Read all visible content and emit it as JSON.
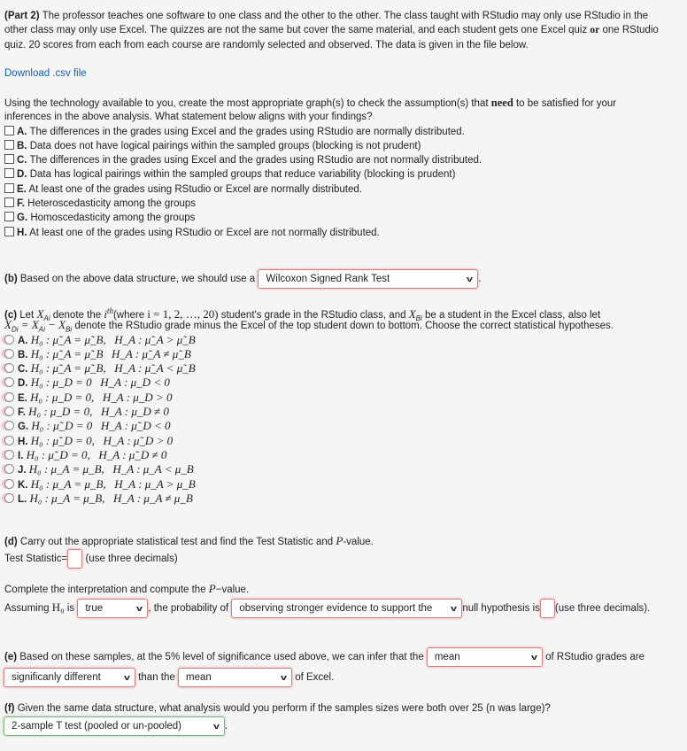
{
  "intro": {
    "part_label": "(Part 2)",
    "lines": [
      "The professor teaches one software to one class and the other to the other. The class taught with RStudio may only use RStudio in the",
      "other class may only use Excel. The quizzes are not the same but cover the same material, and each student gets one Excel quiz",
      "quiz. 20 scores from each from each course are randomly selected and observed. The data is given in the file below."
    ],
    "or_word": "or",
    "line2_end": "one RStudio",
    "download_link": "Download .csv file"
  },
  "part_a": {
    "prompt_1a": "Using the technology available to you, create the most appropriate graph(s) to check the assumption(s) that",
    "need_word": "need",
    "prompt_1b": "to be satisfied for your",
    "prompt_2": "inferences in the above analysis. What statement below aligns with your findings?",
    "options": [
      {
        "letter": "A.",
        "text": "The differences in the grades using Excel and the grades using RStudio are normally distributed."
      },
      {
        "letter": "B.",
        "text": "Data does not have logical pairings within the sampled groups (blocking is not prudent)"
      },
      {
        "letter": "C.",
        "text": "The differences in the grades using Excel and the grades using RStudio are not normally distributed."
      },
      {
        "letter": "D.",
        "text": "Data has logical pairings within the sampled groups that reduce variability (blocking is prudent)"
      },
      {
        "letter": "E.",
        "text": "At least one of the grades using RStudio or Excel are normally distributed."
      },
      {
        "letter": "F.",
        "text": "Heteroscedasticity among the groups"
      },
      {
        "letter": "G.",
        "text": "Homoscedasticity among the groups"
      },
      {
        "letter": "H.",
        "text": "At least one of the grades using RStudio or Excel are not normally distributed."
      }
    ]
  },
  "part_b": {
    "label": "(b)",
    "prompt": "Based on the above data structure, we should use a",
    "selected": "Wilcoxon Signed Rank Test",
    "end": "."
  },
  "part_c": {
    "label": "(c)",
    "l1a": "Let",
    "xa": "X",
    "xa_sub": "Ai",
    "l1b": "denote the",
    "ith": "i",
    "ith_sup": "th",
    "l1c": "(where",
    "range": "i = 1, 2, …, 20)",
    "l1d": "student's grade in the RStudio class, and",
    "xb_sub": "Bi",
    "l1e": "be a student in the Excel class, also let",
    "l2_math": "X",
    "xd_sub": "Di",
    "l2_eq": " = X",
    "l2_minus": " − X",
    "l2_rest": "denote the RStudio grade minus the Excel of the top student down to bottom. Choose the correct statistical hypotheses.",
    "options": [
      {
        "letter": "A.",
        "h0": "H₀ : μ̃_A = μ̃_B,",
        "ha": "H_A : μ̃_A > μ̃_B"
      },
      {
        "letter": "B.",
        "h0": "H₀ : μ̃_A = μ̃_B",
        "ha": "H_A : μ̃_A ≠ μ̃_B"
      },
      {
        "letter": "C.",
        "h0": "H₀ : μ̃_A = μ̃_B,",
        "ha": "H_A : μ̃_A < μ̃_B"
      },
      {
        "letter": "D.",
        "h0": "H₀ : μ_D = 0",
        "ha": "H_A : μ_D < 0"
      },
      {
        "letter": "E.",
        "h0": "H₀ : μ_D = 0,",
        "ha": "H_A : μ_D > 0"
      },
      {
        "letter": "F.",
        "h0": "H₀ : μ_D = 0,",
        "ha": "H_A : μ_D ≠ 0"
      },
      {
        "letter": "G.",
        "h0": "H₀ : μ̃_D = 0",
        "ha": "H_A : μ̃_D < 0"
      },
      {
        "letter": "H.",
        "h0": "H₀ : μ̃_D = 0,",
        "ha": "H_A : μ̃_D > 0"
      },
      {
        "letter": "I.",
        "h0": "H₀ : μ̃_D = 0,",
        "ha": "H_A : μ̃_D ≠ 0"
      },
      {
        "letter": "J.",
        "h0": "H₀ : μ_A = μ_B,",
        "ha": "H_A : μ_A < μ_B"
      },
      {
        "letter": "K.",
        "h0": "H₀ : μ_A = μ_B,",
        "ha": "H_A : μ_A > μ_B"
      },
      {
        "letter": "L.",
        "h0": "H₀ : μ_A = μ_B,",
        "ha": "H_A : μ_A ≠ μ_B"
      }
    ]
  },
  "part_d": {
    "label": "(d)",
    "prompt_a": "Carry out the appropriate statistical test and find the Test Statistic and",
    "p": "P",
    "prompt_b": "-value.",
    "ts_label": "Test Statistic=",
    "ts_value": "",
    "ts_hint": "(use three decimals)",
    "interp_a": "Complete the interpretation and compute the",
    "interp_b": "−value.",
    "assuming": "Assuming",
    "h0": "H₀",
    "is": "is",
    "select_true": "true",
    "prob_of": ", the probability of",
    "select_evidence": "observing stronger evidence to support the",
    "null_is": "null hypothesis is",
    "p_value": "",
    "p_hint": "(use three decimals)."
  },
  "part_e": {
    "label": "(e)",
    "prompt": "Based on these samples, at the 5% level of significance used above, we can infer that the",
    "select_1": "mean",
    "after_1": "of RStudio grades are",
    "select_2": "significanly different",
    "than_the": "than the",
    "select_3": "mean",
    "after_3": "of Excel."
  },
  "part_f": {
    "label": "(f)",
    "prompt": "Given the same data structure, what analysis would you perform if the samples sizes were both over 25 (n was large)?",
    "selected": "2-sample T test (pooled or un-pooled)",
    "end": "."
  }
}
